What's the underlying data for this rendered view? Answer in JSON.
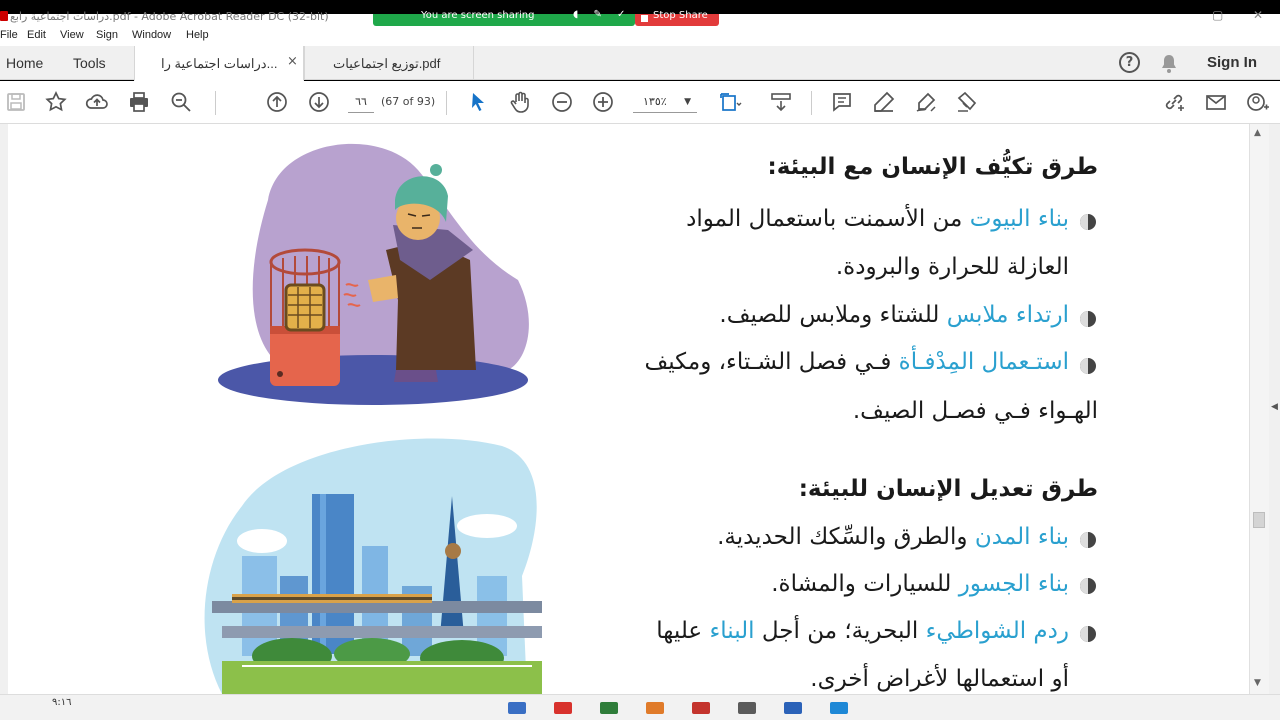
{
  "window": {
    "title": "دراسات اجتماعية رابع.pdf - Adobe Acrobat Reader DC (32-bit)",
    "share_text": "You are screen sharing",
    "stop_share": "Stop Share"
  },
  "menu": [
    "File",
    "Edit",
    "View",
    "Sign",
    "Window",
    "Help"
  ],
  "tabs": {
    "home": "Home",
    "tools": "Tools",
    "docs": [
      {
        "label": "دراسات اجتماعية را...",
        "active": true
      },
      {
        "label": "توزيع اجتماعيات.pdf",
        "active": false
      }
    ],
    "close": "×",
    "sign_in": "Sign In"
  },
  "toolbar": {
    "page_number": "٦٦",
    "page_of": "(67 of 93)",
    "zoom": "١٣٥٪"
  },
  "document": {
    "section1": {
      "heading": "طرق تكيُّف الإنسان مع البيئة:",
      "items": [
        {
          "highlight": "بناء البيوت",
          "text": " من الأسمنت باستعمال المواد",
          "continuation": "العازلة للحرارة والبرودة."
        },
        {
          "highlight": "ارتداء ملابس",
          "text": " للشتاء وملابس للصيف.",
          "continuation": ""
        },
        {
          "highlight": "استـعمال المِدْفـأة",
          "text": " فـي فصل الشـتاء، ومكيف",
          "continuation": "الهـواء فـي فصـل الصيف."
        }
      ]
    },
    "section2": {
      "heading": "طرق تعديل الإنسان للبيئة:",
      "items": [
        {
          "highlight": "بناء المدن",
          "text": " والطرق والسِّكك الحديدية.",
          "continuation": ""
        },
        {
          "highlight": "بناء الجسور",
          "text": " للسيارات والمشاة.",
          "continuation": ""
        },
        {
          "highlight": "ردم الشواطيء",
          "text": " البحرية؛ من أجل ",
          "highlight2": "البناء",
          "text2": " عليها",
          "continuation": "أو استعمالها لأغراض أخرى."
        }
      ]
    }
  },
  "taskbar": {
    "time": "٩:١٦"
  },
  "colors": {
    "accent": "#2aa0cf",
    "share_green": "#1fa84a",
    "stop_red": "#e23b3b"
  }
}
